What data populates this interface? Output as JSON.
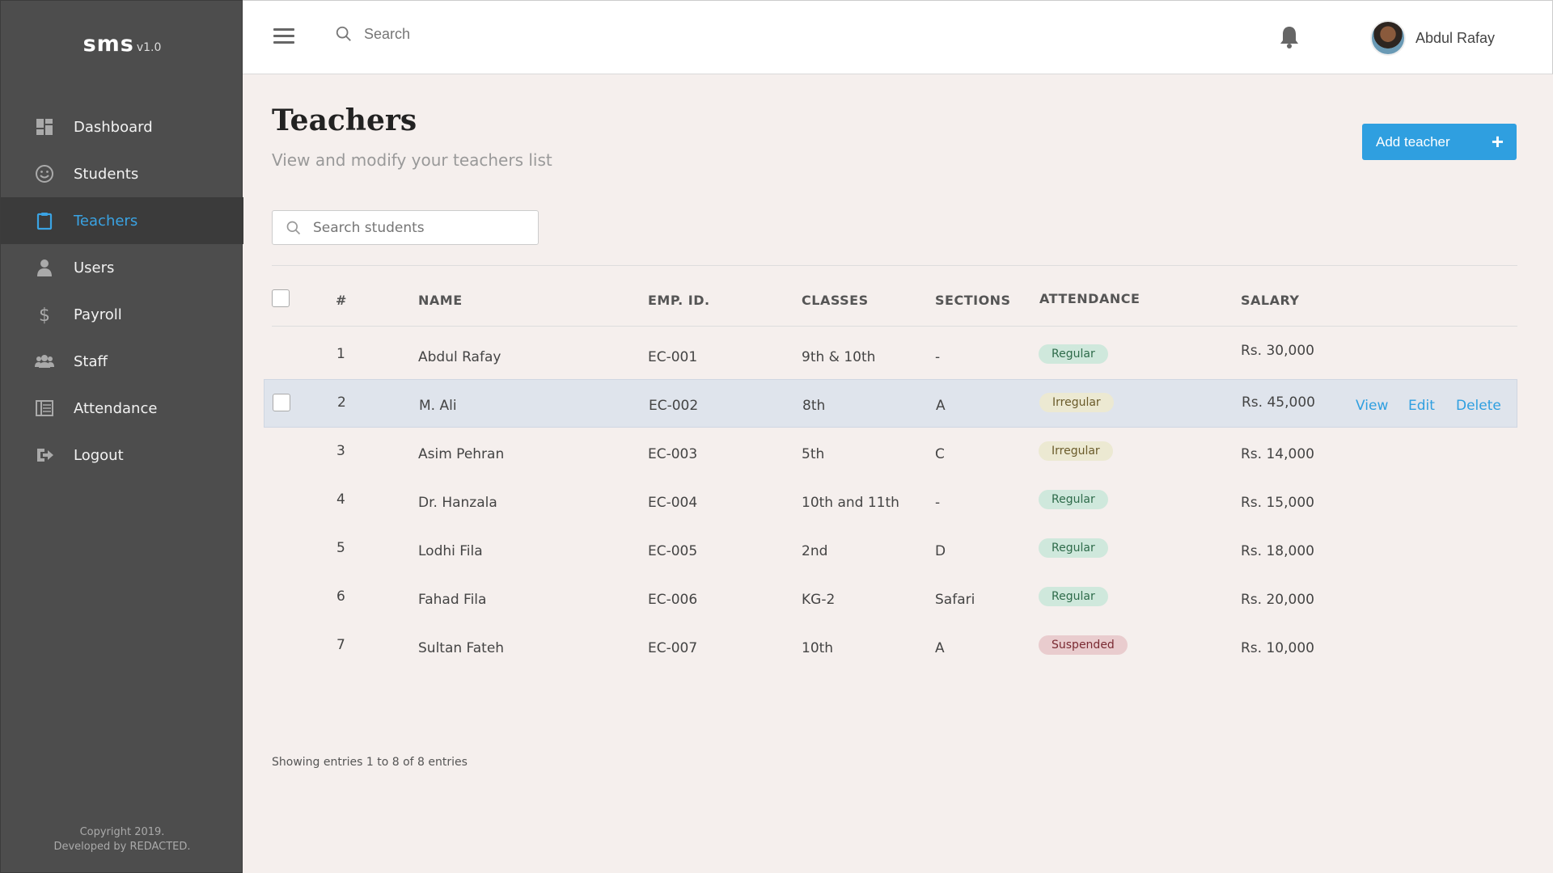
{
  "brand": {
    "name": "sms",
    "version": "v1.0"
  },
  "sidebar": {
    "items": [
      {
        "label": "Dashboard",
        "icon": "dashboard-icon"
      },
      {
        "label": "Students",
        "icon": "smiley-icon"
      },
      {
        "label": "Teachers",
        "icon": "clipboard-icon",
        "active": true
      },
      {
        "label": "Users",
        "icon": "user-icon"
      },
      {
        "label": "Payroll",
        "icon": "dollar-icon"
      },
      {
        "label": "Staff",
        "icon": "group-icon"
      },
      {
        "label": "Attendance",
        "icon": "register-icon"
      },
      {
        "label": "Logout",
        "icon": "logout-icon"
      }
    ],
    "footer_line1": "Copyright 2019.",
    "footer_line2": "Developed by REDACTED."
  },
  "topbar": {
    "search_placeholder": "Search",
    "user_name": "Abdul Rafay"
  },
  "main": {
    "title": "Teachers",
    "subtitle": "View and modify your teachers list",
    "add_button": "Add teacher",
    "add_button_icon": "+",
    "search_placeholder": "Search students",
    "columns": {
      "num": "#",
      "name": "NAME",
      "emp_id": "EMP. ID.",
      "classes": "CLASSES",
      "sections": "SECTIONS",
      "attendance": "ATTENDANCE",
      "salary": "SALARY"
    },
    "rows": [
      {
        "num": "1",
        "name": "Abdul Rafay",
        "emp_id": "EC-001",
        "classes": "9th & 10th",
        "sections": "-",
        "attendance": "Regular",
        "salary": "Rs. 30,000"
      },
      {
        "num": "2",
        "name": "M. Ali",
        "emp_id": "EC-002",
        "classes": "8th",
        "sections": "A",
        "attendance": "Irregular",
        "salary": "Rs. 45,000"
      },
      {
        "num": "3",
        "name": "Asim Pehran",
        "emp_id": "EC-003",
        "classes": "5th",
        "sections": "C",
        "attendance": "Irregular",
        "salary": "Rs. 14,000"
      },
      {
        "num": "4",
        "name": "Dr. Hanzala",
        "emp_id": "EC-004",
        "classes": "10th and 11th",
        "sections": "-",
        "attendance": "Regular",
        "salary": "Rs. 15,000"
      },
      {
        "num": "5",
        "name": "Lodhi Fila",
        "emp_id": "EC-005",
        "classes": "2nd",
        "sections": "D",
        "attendance": "Regular",
        "salary": "Rs. 18,000"
      },
      {
        "num": "6",
        "name": "Fahad Fila",
        "emp_id": "EC-006",
        "classes": "KG-2",
        "sections": "Safari",
        "attendance": "Regular",
        "salary": "Rs. 20,000"
      },
      {
        "num": "7",
        "name": "Sultan Fateh",
        "emp_id": "EC-007",
        "classes": "10th",
        "sections": "A",
        "attendance": "Suspended",
        "salary": "Rs. 10,000"
      }
    ],
    "row_actions": {
      "view": "View",
      "edit": "Edit",
      "delete": "Delete"
    },
    "entries_text": "Showing entries 1 to 8 of 8 entries"
  },
  "colors": {
    "accent": "#2f9fe0",
    "sidebar_bg": "#4d4d4d",
    "page_bg": "#f5efed",
    "regular": "#cfe8dc",
    "irregular": "#ece9d2",
    "suspended": "#e9ccce"
  }
}
